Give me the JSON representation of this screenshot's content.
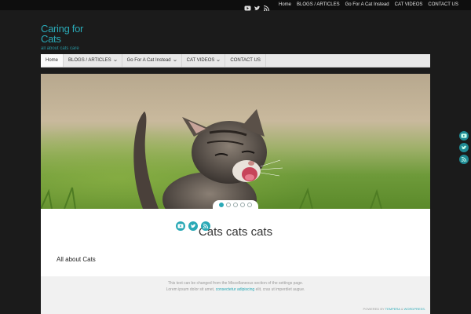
{
  "topbar": {
    "social": [
      "youtube-icon",
      "twitter-icon",
      "rss-icon"
    ],
    "menu": [
      "Home",
      "BLOGS / ARTICLES",
      "Go For A Cat Instead",
      "CAT VIDEOS",
      "CONTACT US"
    ]
  },
  "site": {
    "title": "Caring for Cats",
    "description": "all about cats care"
  },
  "nav": {
    "items": [
      {
        "label": "Home",
        "active": true
      },
      {
        "label": "BLOGS / ARTICLES",
        "dropdown": true
      },
      {
        "label": "Go For A Cat Instead",
        "dropdown": true
      },
      {
        "label": "CAT VIDEOS",
        "dropdown": true
      },
      {
        "label": "CONTACT US"
      }
    ]
  },
  "slider": {
    "slide_count": 5,
    "active_index": 0
  },
  "page": {
    "heading": "Cats cats cats",
    "text": "All about Cats"
  },
  "footer": {
    "line1": "This text can be changed from the Miscellaneous section of the settings page.",
    "line2_pre": "Lorem ipsum dolor sit amet, ",
    "line2_link": "consectetur adipiscing",
    "line2_post": " elit, cras ut imperdiet augue.",
    "social": [
      "youtube-icon",
      "twitter-icon",
      "rss-icon"
    ],
    "powered_pre": "POWERED BY ",
    "powered_theme": "TEMPERA",
    "powered_amp": " & ",
    "powered_wp": "WORDPRESS."
  },
  "colors": {
    "accent": "#2aa9b6",
    "background": "#1b1b1b"
  }
}
